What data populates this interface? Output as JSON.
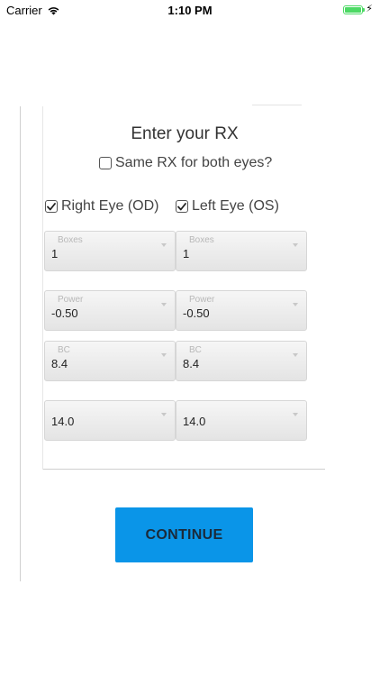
{
  "status_bar": {
    "carrier": "Carrier",
    "time": "1:10 PM",
    "wifi_icon": "wifi-icon",
    "battery_level": 1.0,
    "battery_color": "#4cd964",
    "charging_icon": "bolt-icon"
  },
  "form": {
    "title": "Enter your RX",
    "same_rx": {
      "label": "Same RX for both eyes?",
      "checked": false
    },
    "right_eye": {
      "label": "Right Eye (OD)",
      "checked": true
    },
    "left_eye": {
      "label": "Left Eye (OS)",
      "checked": true
    },
    "right": {
      "boxes": {
        "label": "Boxes",
        "value": "1"
      },
      "power": {
        "label": "Power",
        "value": "-0.50"
      },
      "bc": {
        "label": "BC",
        "value": "8.4"
      },
      "dia": {
        "label": "",
        "value": "14.0"
      }
    },
    "left": {
      "boxes": {
        "label": "Boxes",
        "value": "1"
      },
      "power": {
        "label": "Power",
        "value": "-0.50"
      },
      "bc": {
        "label": "BC",
        "value": "8.4"
      },
      "dia": {
        "label": "",
        "value": "14.0"
      }
    },
    "continue_label": "CONTINUE",
    "accent_color": "#0a95e8"
  }
}
